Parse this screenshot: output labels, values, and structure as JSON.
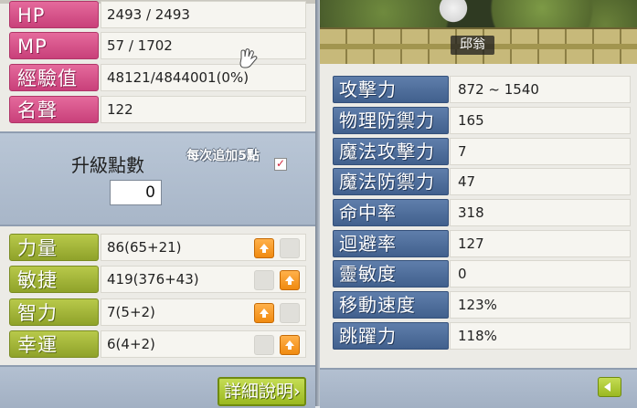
{
  "basic_info": [
    {
      "label": "HP",
      "value": "2493 / 2493"
    },
    {
      "label": "MP",
      "value": "57 / 1702"
    },
    {
      "label": "經驗值",
      "value": "48121/4844001(0%)"
    },
    {
      "label": "名聲",
      "value": "122"
    }
  ],
  "ability_points": {
    "label": "升級點數",
    "value": "0",
    "auto_assign_label": "每次追加5點",
    "auto_assign_checked": true
  },
  "stats": [
    {
      "label": "力量",
      "value": "86(65+21)"
    },
    {
      "label": "敏捷",
      "value": "419(376+43)"
    },
    {
      "label": "智力",
      "value": "7(5+2)"
    },
    {
      "label": "幸運",
      "value": "6(4+2)"
    }
  ],
  "detail_button": "詳細說明",
  "npc_name": "邱翁",
  "detail_stats": [
    {
      "label": "攻擊力",
      "value": "872 ~ 1540"
    },
    {
      "label": "物理防禦力",
      "value": "165"
    },
    {
      "label": "魔法攻擊力",
      "value": "7"
    },
    {
      "label": "魔法防禦力",
      "value": "47"
    },
    {
      "label": "命中率",
      "value": "318"
    },
    {
      "label": "迴避率",
      "value": "127"
    },
    {
      "label": "靈敏度",
      "value": "0"
    },
    {
      "label": "移動速度",
      "value": "123%"
    },
    {
      "label": "跳躍力",
      "value": "118%"
    }
  ],
  "colors": {
    "pink_label": "#d4558a",
    "green_label": "#a3b636",
    "blue_label": "#4f6e9c",
    "up_arrow": "#f39a1f"
  },
  "icons": {
    "up_arrow": "up-arrow-icon",
    "back": "back-arrow-icon",
    "cursor": "hand-cursor-icon"
  }
}
